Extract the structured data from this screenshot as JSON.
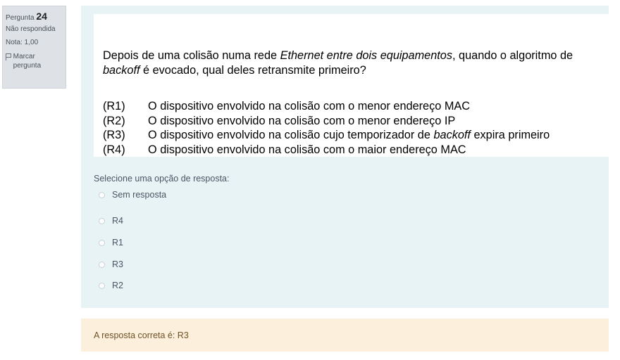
{
  "info": {
    "question_label": "Pergunta",
    "question_number": "24",
    "status": "Não respondida",
    "grade": "Nota: 1,00",
    "flag_label": "Marcar pergunta",
    "flag_icon": "flag-icon"
  },
  "question": {
    "text_1": "Depois de uma colisão numa rede ",
    "text_italic_1": "Ethernet entre dois equipamentos",
    "text_2": ", quando o algoritmo de ",
    "text_italic_2": "backoff",
    "text_3": " é evocado, qual deles retransmite primeiro?",
    "options": [
      {
        "code": "(R1)",
        "text": "O dispositivo envolvido na colisão com o menor endereço MAC"
      },
      {
        "code": "(R2)",
        "text": "O dispositivo envolvido na colisão com o menor endereço IP"
      },
      {
        "code": "(R3)",
        "text_a": "O dispositivo envolvido na colisão cujo temporizador de ",
        "text_italic": "backoff",
        "text_b": " expira primeiro"
      },
      {
        "code": "(R4)",
        "text": "O dispositivo envolvido na colisão com o maior endereço MAC"
      }
    ]
  },
  "answer": {
    "prompt": "Selecione uma opção de resposta:",
    "choices": [
      "Sem resposta",
      "R4",
      "R1",
      "R3",
      "R2"
    ],
    "selected": "none"
  },
  "feedback": {
    "text": "A resposta correta é: R3"
  },
  "colors": {
    "question_bg": "#e7f3f5",
    "info_bg": "#dee2e6",
    "feedback_bg": "#fcefdc",
    "feedback_text": "#6e5227"
  }
}
